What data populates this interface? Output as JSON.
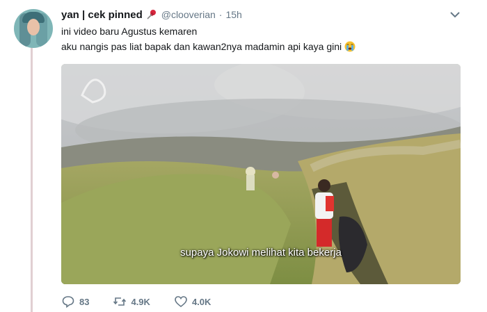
{
  "tweet": {
    "display_name": "yan | cek pinned",
    "handle": "@clooverian",
    "separator": "·",
    "time": "15h",
    "line1": "ini video baru Agustus kemaren",
    "line2": "aku nangis pas liat bapak dan kawan2nya madamin api kaya gini",
    "media_subtitle": "supaya Jokowi melihat kita bekerja",
    "replies": "83",
    "retweets": "4.9K",
    "likes": "4.0K"
  },
  "icons": {
    "pin": "pin-icon",
    "cry": "loudly-crying-face-icon",
    "menu": "chevron-down-icon",
    "reply": "reply-icon",
    "retweet": "retweet-icon",
    "like": "heart-icon"
  },
  "colors": {
    "muted_text": "#657786",
    "pin_red": "#d7263d",
    "thread_line": "#e1cfd2"
  }
}
